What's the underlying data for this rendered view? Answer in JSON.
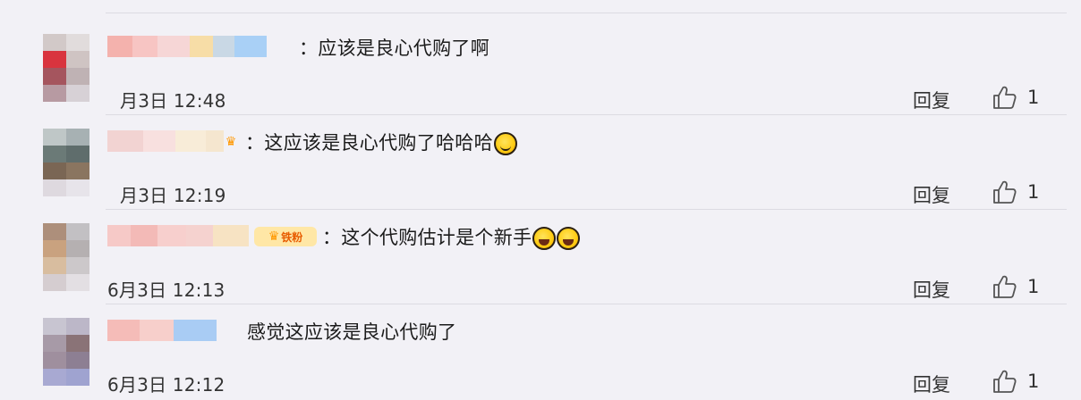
{
  "comments": [
    {
      "text": "：应该是良心代购了啊",
      "time": "月3日 12:48",
      "reply": "回复",
      "likes": "1"
    },
    {
      "text": "：这应该是良心代购了哈哈哈",
      "time": "月3日 12:19",
      "reply": "回复",
      "likes": "1"
    },
    {
      "badge": "铁粉",
      "text": "：这个代购估计是个新手",
      "time": "6月3日 12:13",
      "reply": "回复",
      "likes": "1"
    },
    {
      "text": "感觉这应该是良心代购了",
      "time": "6月3日 12:12",
      "reply": "回复",
      "likes": "1"
    }
  ],
  "icons": {
    "like": "thumb-up-icon",
    "emoji_smile": "grin-emoji-icon",
    "emoji_cry": "laugh-cry-emoji-icon",
    "crown": "crown-icon"
  }
}
